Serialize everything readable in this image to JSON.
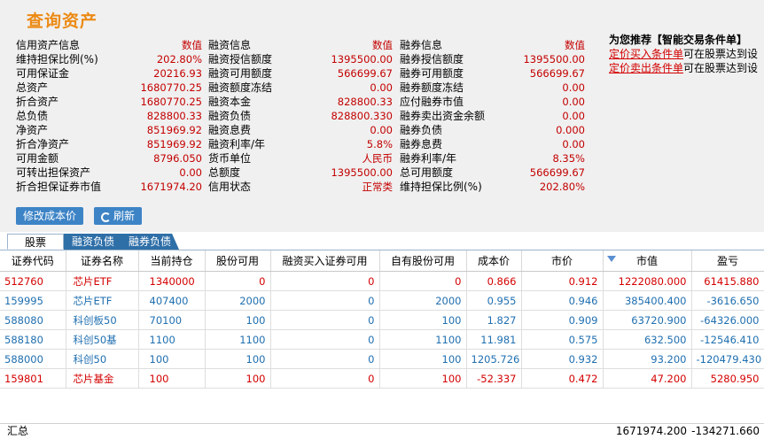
{
  "title": "查询资产",
  "col1": {
    "header_label": "信用资产信息",
    "header_value": "数值",
    "rows": [
      {
        "label": "维持担保比例(%)",
        "value": "202.80%"
      },
      {
        "label": "可用保证金",
        "value": "20216.93"
      },
      {
        "label": "总资产",
        "value": "1680770.25"
      },
      {
        "label": "折合资产",
        "value": "1680770.25"
      },
      {
        "label": "总负债",
        "value": "828800.33"
      },
      {
        "label": "净资产",
        "value": "851969.92"
      },
      {
        "label": "折合净资产",
        "value": "851969.92"
      },
      {
        "label": "可用金额",
        "value": "8796.050"
      },
      {
        "label": "可转出担保资产",
        "value": "0.00"
      },
      {
        "label": "折合担保证券市值",
        "value": "1671974.20"
      }
    ]
  },
  "col2": {
    "header_label": "融资信息",
    "header_value": "数值",
    "rows": [
      {
        "label": "融资授信额度",
        "value": "1395500.00"
      },
      {
        "label": "融资可用额度",
        "value": "566699.67"
      },
      {
        "label": "融资额度冻结",
        "value": "0.00"
      },
      {
        "label": "融资本金",
        "value": "828800.33"
      },
      {
        "label": "融资负债",
        "value": "828800.330"
      },
      {
        "label": "融资息费",
        "value": "0.00"
      },
      {
        "label": "融资利率/年",
        "value": "5.8%"
      },
      {
        "label": "货币单位",
        "value": "人民币"
      },
      {
        "label": "总额度",
        "value": "1395500.00"
      },
      {
        "label": "信用状态",
        "value": "正常类"
      }
    ]
  },
  "col3": {
    "header_label": "融券信息",
    "header_value": "数值",
    "rows": [
      {
        "label": "融券授信额度",
        "value": "1395500.00"
      },
      {
        "label": "融券可用额度",
        "value": "566699.67"
      },
      {
        "label": "融券额度冻结",
        "value": "0.00"
      },
      {
        "label": "应付融券市值",
        "value": "0.00"
      },
      {
        "label": "融券卖出资金余额",
        "value": "0.00"
      },
      {
        "label": "融券负债",
        "value": "0.000"
      },
      {
        "label": "融券息费",
        "value": "0.00"
      },
      {
        "label": "融券利率/年",
        "value": "8.35%"
      },
      {
        "label": "总可用额度",
        "value": "566699.67"
      },
      {
        "label": "维持担保比例(%)",
        "value": "202.80%"
      }
    ]
  },
  "buttons": {
    "edit_cost": "修改成本价",
    "refresh": "刷新"
  },
  "recommend": {
    "title": "为您推荐【智能交易条件单】",
    "lines": [
      {
        "link": "定价买入条件单",
        "text": "可在股票达到设"
      },
      {
        "link": "定价卖出条件单",
        "text": "可在股票达到设"
      }
    ]
  },
  "tabs": [
    "股票",
    "融资负债",
    "融券负债"
  ],
  "table": {
    "columns": [
      "证券代码",
      "证券名称",
      "当前持仓",
      "股份可用",
      "融资买入证券可用",
      "自有股份可用",
      "成本价",
      "市价",
      "市值",
      "盈亏"
    ],
    "rows": [
      {
        "dir": "up",
        "cells": [
          "512760",
          "芯片ETF",
          "1340000",
          "0",
          "0",
          "0",
          "0.866",
          "0.912",
          "1222080.000",
          "61415.880"
        ]
      },
      {
        "dir": "down",
        "cells": [
          "159995",
          "芯片ETF",
          "407400",
          "2000",
          "0",
          "2000",
          "0.955",
          "0.946",
          "385400.400",
          "-3616.650"
        ]
      },
      {
        "dir": "down",
        "cells": [
          "588080",
          "科创板50",
          "70100",
          "100",
          "0",
          "100",
          "1.827",
          "0.909",
          "63720.900",
          "-64326.000"
        ]
      },
      {
        "dir": "down",
        "cells": [
          "588180",
          "科创50基",
          "1100",
          "1100",
          "0",
          "1100",
          "11.981",
          "0.575",
          "632.500",
          "-12546.410"
        ]
      },
      {
        "dir": "down",
        "cells": [
          "588000",
          "科创50",
          "100",
          "100",
          "0",
          "100",
          "1205.726",
          "0.932",
          "93.200",
          "-120479.430"
        ]
      },
      {
        "dir": "up",
        "cells": [
          "159801",
          "芯片基金",
          "100",
          "100",
          "0",
          "100",
          "-52.337",
          "0.472",
          "47.200",
          "5280.950"
        ]
      }
    ]
  },
  "totals": {
    "label": "汇总",
    "market_value": "1671974.200",
    "profit_loss": "-134271.660"
  },
  "colors": {
    "accent": "#ec8a14",
    "up": "#d40000",
    "down": "#1f6fb0",
    "button": "#3d84c6"
  }
}
